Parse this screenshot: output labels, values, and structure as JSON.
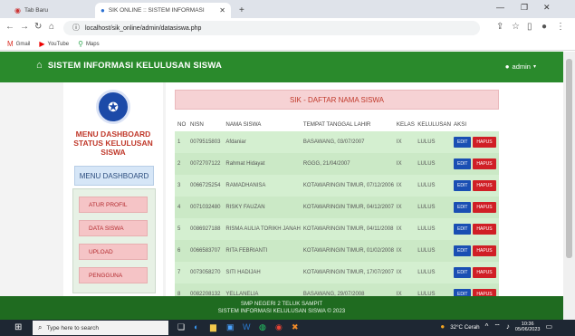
{
  "browser": {
    "tabs": [
      {
        "label": "Tab Baru"
      },
      {
        "label": "SIK ONLINE :: SISTEM INFORMASI"
      }
    ],
    "new_tab": "+",
    "url": "localhost/sik_online/admin/datasiswa.php",
    "bookmarks": [
      "Gmail",
      "YouTube",
      "Maps"
    ]
  },
  "app": {
    "brand": "SISTEM INFORMASI KELULUSAN SISWA",
    "user": "admin"
  },
  "sidebar": {
    "title_line1": "MENU DASHBOARD",
    "title_line2": "STATUS KELULUSAN SISWA",
    "dashboard_button": "MENU DASHBOARD",
    "items": [
      {
        "label": "ATUR PROFIL"
      },
      {
        "label": "DATA SISWA"
      },
      {
        "label": "UPLOAD"
      },
      {
        "label": "PENGGUNA"
      }
    ]
  },
  "main": {
    "heading": "SIK - DAFTAR NAMA SISWA",
    "columns": [
      "NO",
      "NISN",
      "NAMA SISWA",
      "TEMPAT TANGGAL LAHIR",
      "KELAS",
      "KELULUSAN",
      "AKSI"
    ],
    "edit_label": "EDIT",
    "delete_label": "HAPUS",
    "rows": [
      {
        "no": "1",
        "nisn": "0079515803",
        "name": "Afdaniar",
        "ttl": "BASAWANG, 03/07/2007",
        "kelas": "IX",
        "lulus": "LULUS"
      },
      {
        "no": "2",
        "nisn": "0072707122",
        "name": "Rahmat Hidayat",
        "ttl": "RGGG, 21/04/2007",
        "kelas": "IX",
        "lulus": "LULUS"
      },
      {
        "no": "3",
        "nisn": "0066725254",
        "name": "RAMADHANISA",
        "ttl": "KOTAWARINGIN TIMUR, 07/12/2006",
        "kelas": "IX",
        "lulus": "LULUS"
      },
      {
        "no": "4",
        "nisn": "0071032480",
        "name": "RISKY FAUZAN",
        "ttl": "KOTAWARINGIN TIMUR, 04/12/2007",
        "kelas": "IX",
        "lulus": "LULUS"
      },
      {
        "no": "5",
        "nisn": "0086927188",
        "name": "RISMA AULIA TORIKH JANAH",
        "ttl": "KOTAWARINGIN TIMUR, 04/11/2008",
        "kelas": "IX",
        "lulus": "LULUS"
      },
      {
        "no": "6",
        "nisn": "0066583707",
        "name": "RITA FEBRIANTI",
        "ttl": "KOTAWARINGIN TIMUR, 01/02/2008",
        "kelas": "IX",
        "lulus": "LULUS"
      },
      {
        "no": "7",
        "nisn": "0073058270",
        "name": "SITI HADIJAH",
        "ttl": "KOTAWARINGIN TIMUR, 17/07/2007",
        "kelas": "IX",
        "lulus": "LULUS"
      },
      {
        "no": "8",
        "nisn": "0082208132",
        "name": "YELLANELIA",
        "ttl": "BASAWANG, 29/07/2008",
        "kelas": "IX",
        "lulus": "LULUS"
      }
    ]
  },
  "footer": {
    "line1": "SMP NEGERI 2 TELUK SAMPIT",
    "line2": "SISTEM INFORMASI KELULUSAN SISWA © 2023"
  },
  "taskbar": {
    "search_placeholder": "Type here to search",
    "weather": "32°C Cerah",
    "time": "10:36",
    "date": "05/06/2023"
  },
  "colors": {
    "nav_green": "#2a8a2c",
    "footer_green": "#1f6b20",
    "heading_pink": "#f6d2d4",
    "row_green": "#d4efd0",
    "edit_blue": "#1a4fb3",
    "delete_red": "#d01f26"
  }
}
